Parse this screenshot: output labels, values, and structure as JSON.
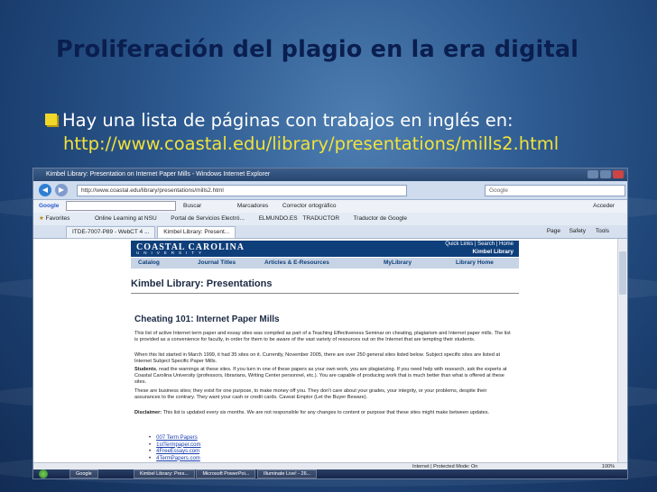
{
  "slide": {
    "title": "Proliferación del plagio en la era digital",
    "bullet": "Hay una lista de páginas con trabajos en inglés en:",
    "url": "http://www.coastal.edu/library/presentations/mills2.html"
  },
  "browser": {
    "window_title": "Kimbel Library: Presentation on Internet Paper Mills - Windows Internet Explorer",
    "address": "http://www.coastal.edu/library/presentations/mills2.html",
    "search_placeholder": "Google",
    "google_bar": {
      "label": "Google",
      "buscar": "Buscar",
      "marcadores": "Marcadores",
      "corrector": "Corrector ortográfico",
      "acceder": "Acceder"
    },
    "favorites": {
      "label": "Favorites",
      "items": [
        "Online Learning at NSU",
        "Portal de Servicios Electró...",
        "ELMUNDO.ES",
        "TRADUCTOR",
        "Traductor de Google"
      ]
    },
    "tabs": [
      "ITDE-7007-P89 - WebCT 4 ...",
      "Kimbel Library: Present..."
    ],
    "toolbar": {
      "page": "Page",
      "safety": "Safety",
      "tools": "Tools"
    },
    "status": "Internet | Protected Mode: On",
    "zoom": "100%"
  },
  "webpage": {
    "logo": "COASTAL CAROLINA",
    "logo_sub": "UNIVERSITY",
    "quick_links": "Quick Links | Search | Home",
    "library_name": "Kimbel Library",
    "nav": [
      "Catalog",
      "Journal Titles",
      "Articles & E-Resources",
      "MyLibrary",
      "Library Home"
    ],
    "page_heading": "Kimbel Library: Presentations",
    "section_heading": "Cheating 101: Internet Paper Mills",
    "p1": "This list of active Internet term paper and essay sites was compiled as part of a Teaching Effectiveness Seminar on cheating, plagiarism and Internet paper mills. The list is provided as a convenience for faculty, in order for them to be aware of the vast variety of resources out on the Internet that are tempting their students.",
    "p2": "When this list started in March 1999, it had 35 sites on it. Currently, November 2005, there are over 250 general sites listed below. Subject specific sites are listed at Internet Subject Specific Paper Mills.",
    "p3_label": "Students",
    "p3": ", read the warnings at these sites. If you turn in one of these papers as your own work, you are plagiarizing. If you need help with research, ask the experts at Coastal Carolina University (professors, librarians, Writing Center personnel, etc.). You are capable of producing work that is much better than what is offered at these sites.",
    "p4": "These are business sites; they exist for one purpose, to make money off you. They don't care about your grades, your integrity, or your problems, despite their assurances to the contrary. They want your cash or credit cards. Caveat Emptor (Let the Buyer Beware).",
    "p5_label": "Disclaimer:",
    "p5": " This list is updated every six months. We are not responsible for any changes to content or purpose that these sites might make between updates.",
    "links": [
      "007 Term Papers",
      "1stTermpaper.com",
      "4FreeEssays.com",
      "4TermPapers.com"
    ]
  },
  "taskbar": {
    "items": [
      "Google",
      "Kimbel Library: Pres...",
      "Microsoft PowerPoi...",
      "Illuminate Live! - 26..."
    ]
  }
}
